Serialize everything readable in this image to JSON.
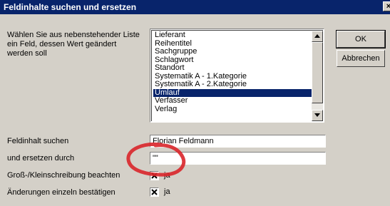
{
  "window": {
    "title": "Feldinhalte suchen und ersetzen",
    "close_glyph": "×"
  },
  "instruction": "Wählen Sie aus nebenstehender Liste ein Feld, dessen Wert geändert werden soll",
  "field_list": {
    "items": [
      "Lieferant",
      "Reihentitel",
      "Sachgruppe",
      "Schlagwort",
      "Standort",
      "Systematik A - 1.Kategorie",
      "Systematik A - 2.Kategorie",
      "Umlauf",
      "Verfasser",
      "Verlag"
    ],
    "selected": "Umlauf"
  },
  "buttons": {
    "ok": "OK",
    "cancel": "Abbrechen"
  },
  "search": {
    "label": "Feldinhalt suchen",
    "value": "Florian Feldmann"
  },
  "replace": {
    "label": "und ersetzen durch",
    "value": "\"\""
  },
  "case_option": {
    "label": "Groß-/Kleinschreibung beachten",
    "checkbox_label": "ja",
    "checked": true
  },
  "confirm_option": {
    "label": "Änderungen einzeln bestätigen",
    "checkbox_label": "ja",
    "checked": true
  },
  "annotation_color": "#d9252a"
}
